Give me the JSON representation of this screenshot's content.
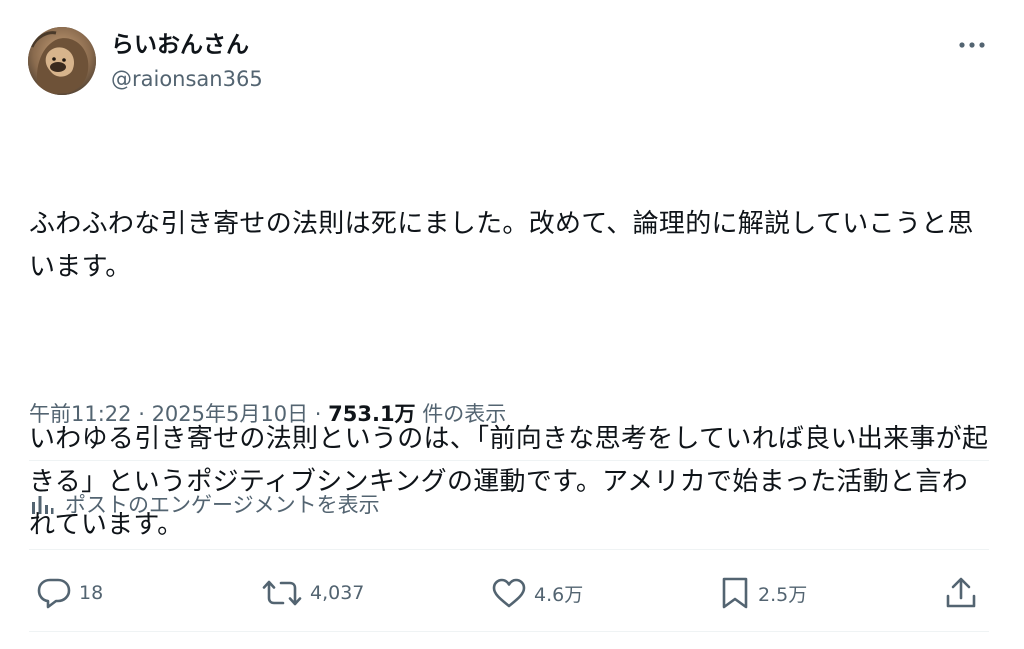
{
  "header": {
    "display_name": "らいおんさん",
    "handle": "@raionsan365",
    "avatar_icon": "lion-avatar",
    "more_icon": "more-dots-icon"
  },
  "tweet": {
    "paragraphs": [
      "ふわふわな引き寄せの法則は死にました。改めて、論理的に解説していこうと思います。",
      "いわゆる引き寄せの法則というのは、「前向きな思考をしていれば良い出来事が起きる」というポジティブシンキングの運動です。アメリカで始まった活動と言われています。"
    ]
  },
  "meta": {
    "time": "午前11:22",
    "separator": " · ",
    "date": "2025年5月10日",
    "views": "753.1万",
    "views_label": " 件の表示"
  },
  "engagement": {
    "label": "ポストのエンゲージメントを表示",
    "icon": "analytics-icon"
  },
  "actions": {
    "replies": "18",
    "reposts": "4,037",
    "likes": "4.6万",
    "bookmarks": "2.5万"
  },
  "colors": {
    "text_primary": "#0f1419",
    "text_secondary": "#536471",
    "divider": "#eff3f4"
  }
}
